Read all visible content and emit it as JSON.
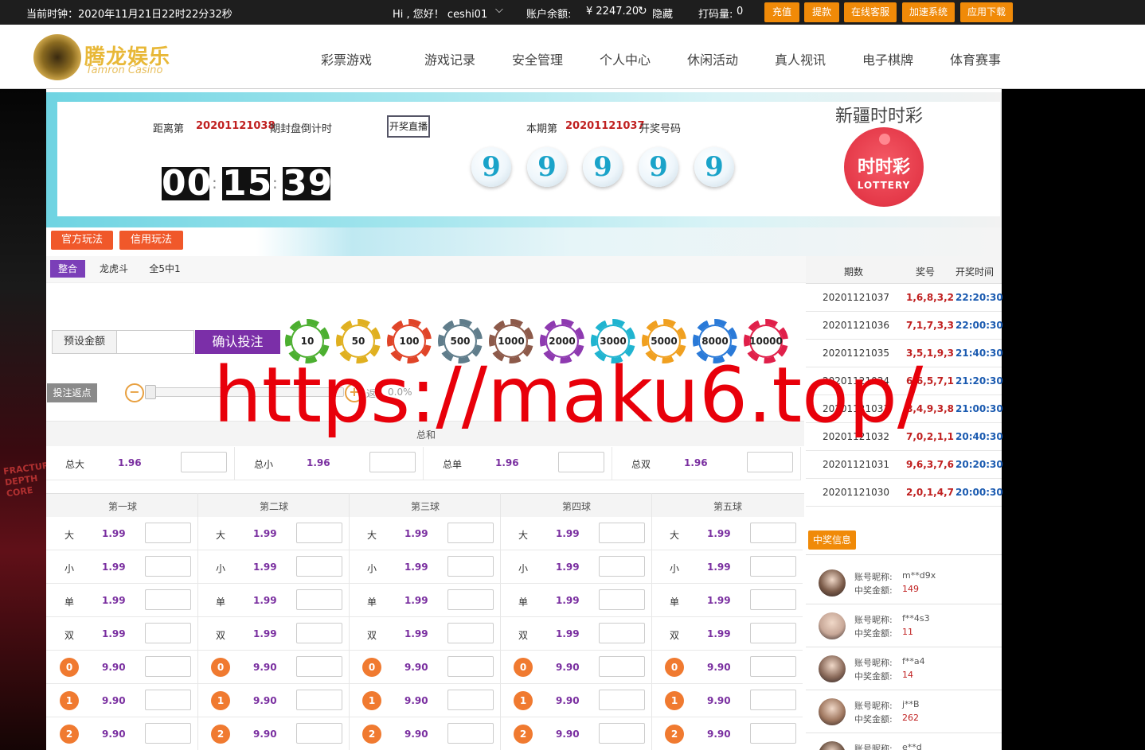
{
  "topbar": {
    "clock": "当前时钟：2020年11月21日22时22分32秒",
    "greeting": "Hi , 您好！ ceshi01",
    "balance_label": "账户余额:",
    "balance_value": "¥ 2247.20",
    "hide_label": "隐藏",
    "wager_label": "打码量:",
    "wager_value": "0",
    "buttons": [
      "充值",
      "提款",
      "在线客服",
      "加速系统",
      "应用下载"
    ]
  },
  "header": {
    "logo_cn": "腾龙娱乐",
    "logo_en": "Tamron Casino",
    "nav": [
      "彩票游戏",
      "游戏记录",
      "安全管理",
      "个人中心",
      "休闲活动",
      "真人视讯",
      "电子棋牌",
      "体育赛事"
    ]
  },
  "banner": {
    "countdown_prefix": "距离第",
    "countdown_issue": "20201121038",
    "countdown_suffix": "期封盘倒计时",
    "live_button": "开奖直播",
    "time": [
      "00",
      "15",
      "39"
    ],
    "draw_prefix": "本期第",
    "draw_issue": "20201121037",
    "draw_suffix": "开奖号码",
    "balls": [
      "9",
      "9",
      "9",
      "9",
      "9"
    ],
    "game_name": "新疆时时彩",
    "logo_cn": "时时彩",
    "logo_en": "LOTTERY"
  },
  "play_modes": [
    "官方玩法",
    "信用玩法"
  ],
  "subtabs": [
    "整合",
    "龙虎斗",
    "全5中1"
  ],
  "bet": {
    "preset_label": "预设金额",
    "confirm_label": "确认投注",
    "chips": [
      "10",
      "50",
      "100",
      "500",
      "1000",
      "2000",
      "3000",
      "5000",
      "8000",
      "10000"
    ],
    "chip_colors": [
      "#4caf30",
      "#e0b020",
      "#e04428",
      "#607d8b",
      "#8d5a4a",
      "#8e3ab0",
      "#20b4d0",
      "#f0a020",
      "#2a7ad8",
      "#e0204a"
    ],
    "rebate_label": "投注返点",
    "rebate_text": "返",
    "rebate_value": "0.0%"
  },
  "total": {
    "title": "总和",
    "items": [
      {
        "label": "总大",
        "odds": "1.96"
      },
      {
        "label": "总小",
        "odds": "1.96"
      },
      {
        "label": "总单",
        "odds": "1.96"
      },
      {
        "label": "总双",
        "odds": "1.96"
      }
    ]
  },
  "balls_table": {
    "headers": [
      "第一球",
      "第二球",
      "第三球",
      "第四球",
      "第五球"
    ],
    "rows": [
      {
        "label": "大",
        "odds": "1.99"
      },
      {
        "label": "小",
        "odds": "1.99"
      },
      {
        "label": "单",
        "odds": "1.99"
      },
      {
        "label": "双",
        "odds": "1.99"
      },
      {
        "num": "0",
        "odds": "9.90"
      },
      {
        "num": "1",
        "odds": "9.90"
      },
      {
        "num": "2",
        "odds": "9.90"
      }
    ]
  },
  "history": {
    "headers": [
      "期数",
      "奖号",
      "开奖时间"
    ],
    "rows": [
      {
        "issue": "20201121037",
        "nums": "1,6,8,3,2",
        "time": "22:20:30"
      },
      {
        "issue": "20201121036",
        "nums": "7,1,7,3,3",
        "time": "22:00:30"
      },
      {
        "issue": "20201121035",
        "nums": "3,5,1,9,3",
        "time": "21:40:30"
      },
      {
        "issue": "20201121034",
        "nums": "6,6,5,7,1",
        "time": "21:20:30"
      },
      {
        "issue": "20201121033",
        "nums": "8,4,9,3,8",
        "time": "21:00:30"
      },
      {
        "issue": "20201121032",
        "nums": "7,0,2,1,1",
        "time": "20:40:30"
      },
      {
        "issue": "20201121031",
        "nums": "9,6,3,7,6",
        "time": "20:20:30"
      },
      {
        "issue": "20201121030",
        "nums": "2,0,1,4,7",
        "time": "20:00:30"
      }
    ]
  },
  "winners": {
    "title": "中奖信息",
    "name_label": "账号昵称:",
    "amount_label": "中奖金额:",
    "rows": [
      {
        "name": "m**d9x",
        "amount": "149",
        "avatar_color": "#7a5a48"
      },
      {
        "name": "f**4s3",
        "amount": "11",
        "avatar_color": "#c8a898"
      },
      {
        "name": "f**a4",
        "amount": "14",
        "avatar_color": "#8a6a5a"
      },
      {
        "name": "j**B",
        "amount": "262",
        "avatar_color": "#a07860"
      },
      {
        "name": "e**d",
        "amount": "",
        "avatar_color": "#6a5040"
      }
    ]
  },
  "watermark": "https://maku6.top/"
}
